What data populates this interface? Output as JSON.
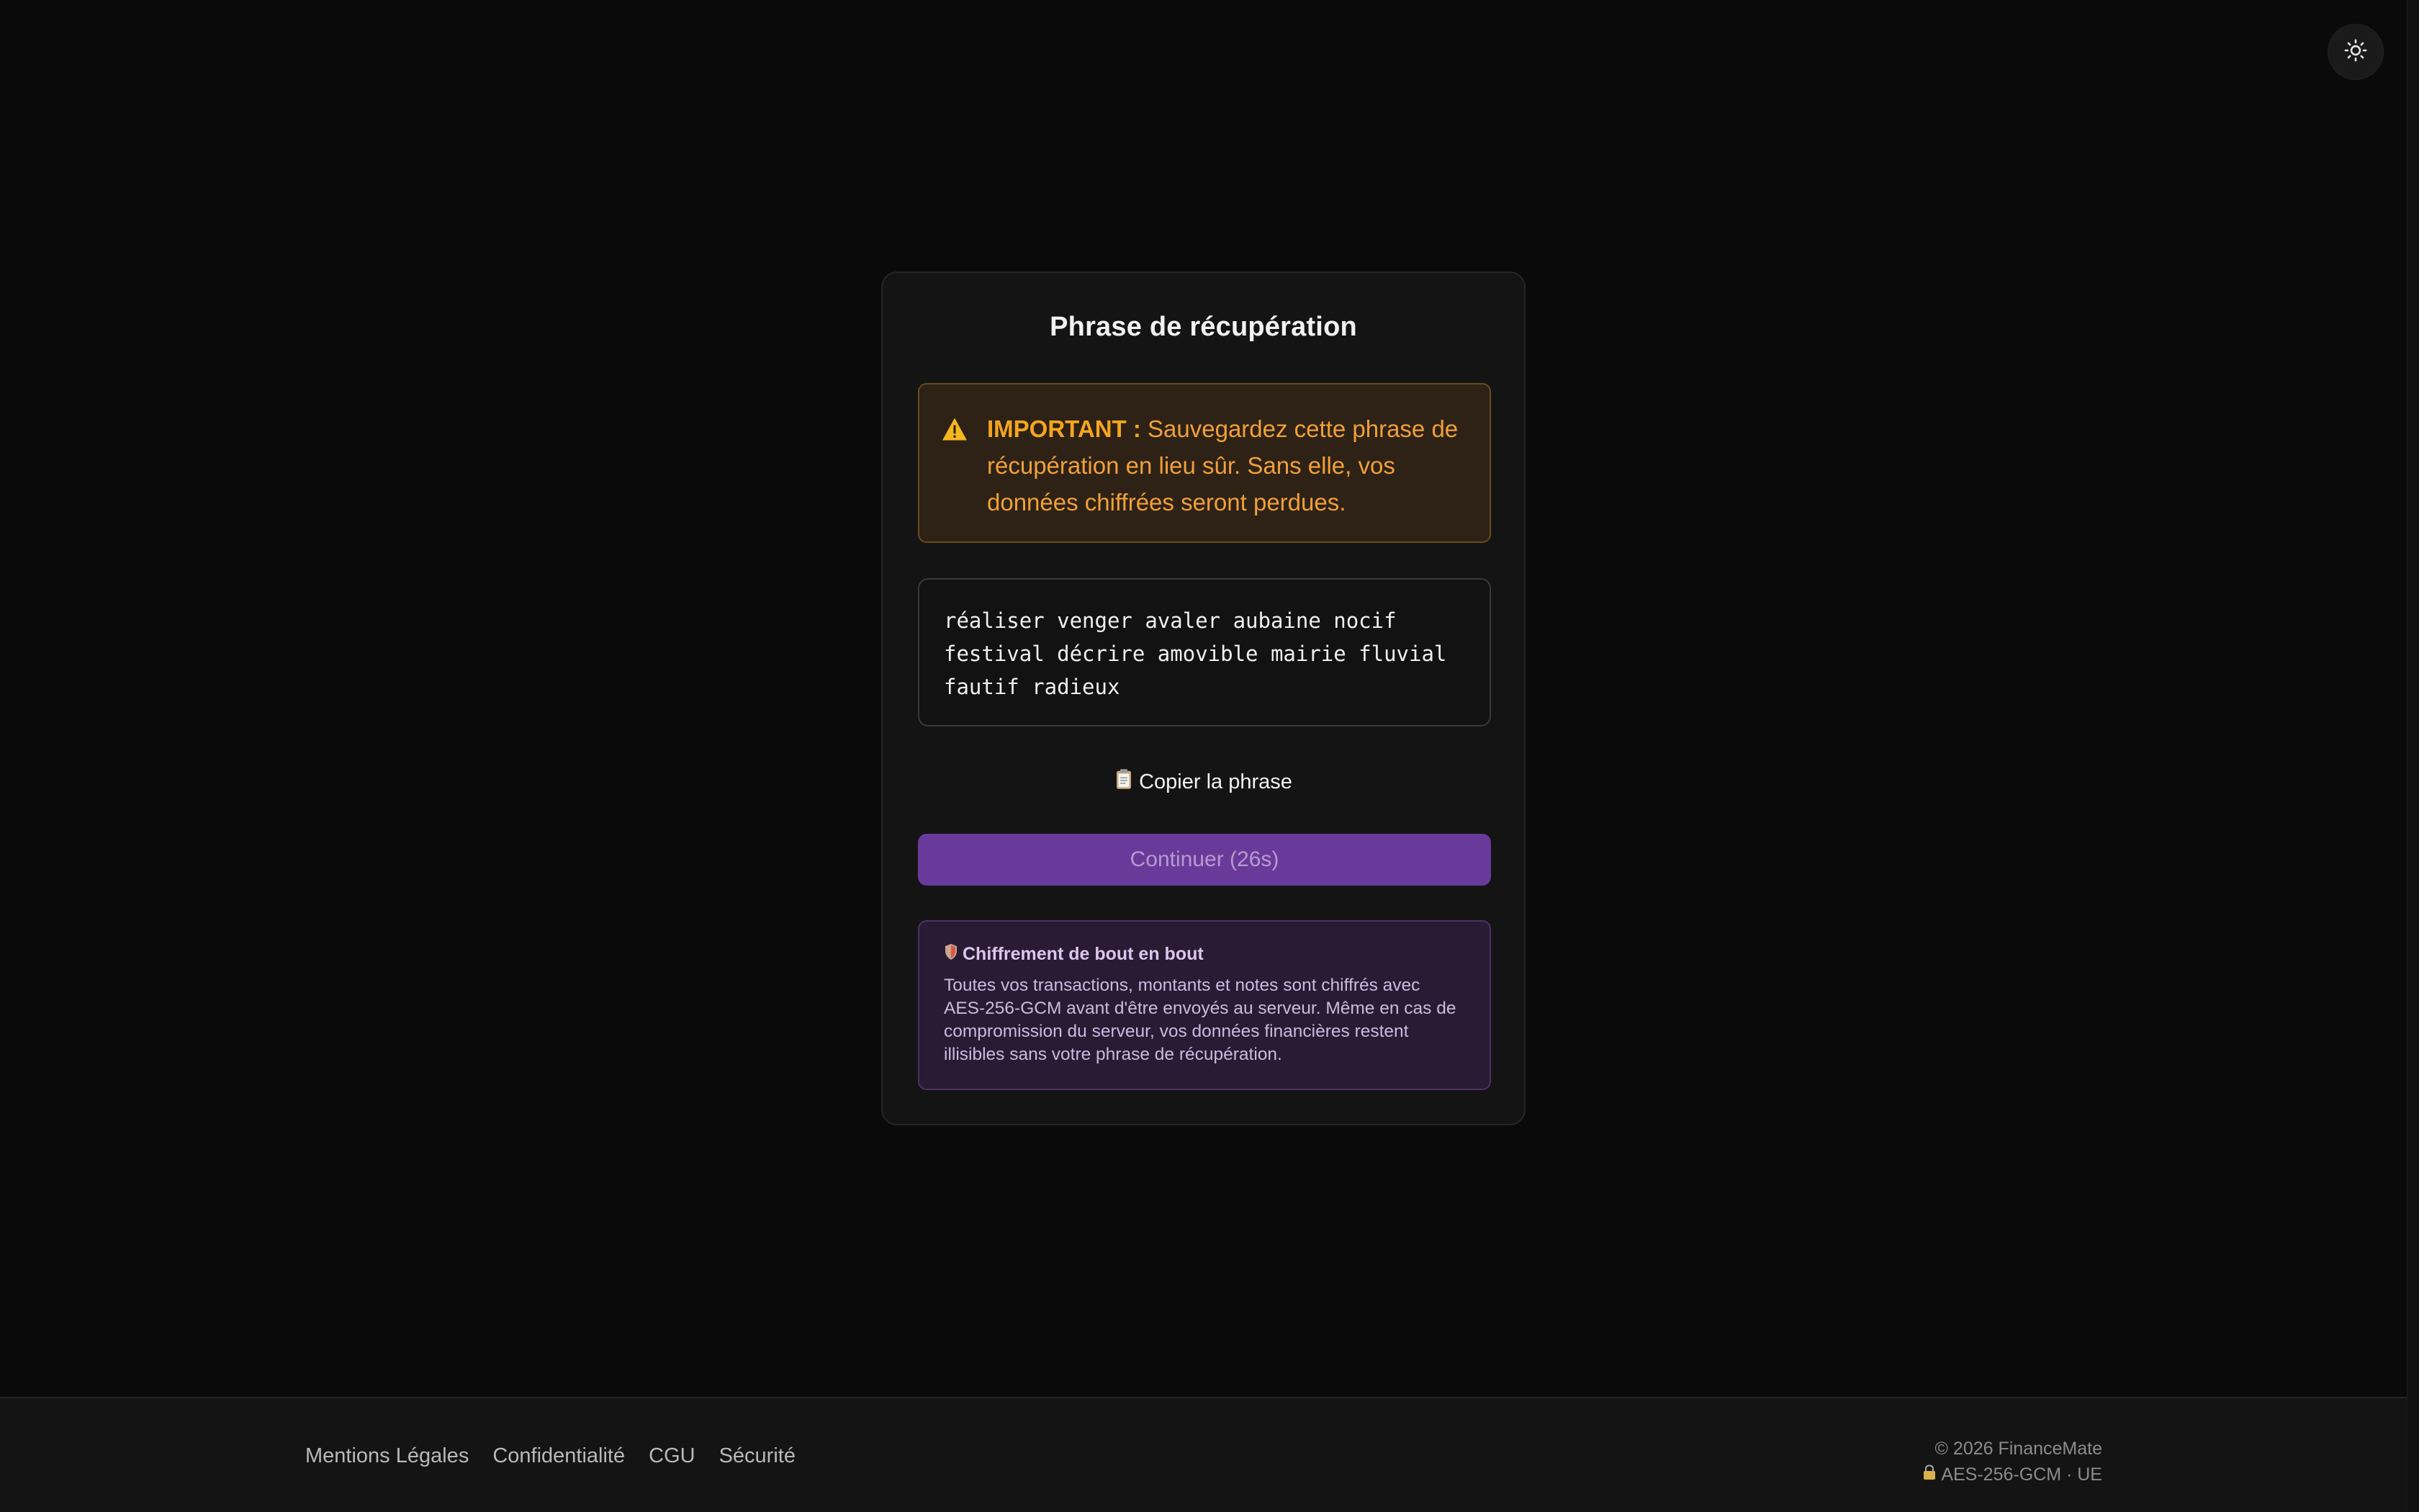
{
  "header": {
    "theme_toggle_icon": "sun-icon"
  },
  "card": {
    "title": "Phrase de récupération",
    "warning": {
      "icon": "warning-triangle-icon",
      "label": "IMPORTANT :",
      "text": "Sauvegardez cette phrase de récupération en lieu sûr. Sans elle, vos données chiffrées seront perdues.",
      "color": "#f0a03a"
    },
    "recovery_phrase": "réaliser venger avaler aubaine nocif festival décrire amovible mairie fluvial fautif radieux",
    "copy_button": {
      "icon": "clipboard-icon",
      "label": "Copier la phrase"
    },
    "continue_button": {
      "label": "Continuer (26s)",
      "color": "#6a3a9a"
    },
    "info": {
      "icon": "shield-icon",
      "title": "Chiffrement de bout en bout",
      "text": "Toutes vos transactions, montants et notes sont chiffrés avec AES-256-GCM avant d'être envoyés au serveur. Même en cas de compromission du serveur, vos données financières restent illisibles sans votre phrase de récupération."
    }
  },
  "footer": {
    "links": [
      "Mentions Légales",
      "Confidentialité",
      "CGU",
      "Sécurité"
    ],
    "copyright": "© 2026 FinanceMate",
    "security_icon": "lock-icon",
    "security_note": "AES-256-GCM · UE"
  }
}
